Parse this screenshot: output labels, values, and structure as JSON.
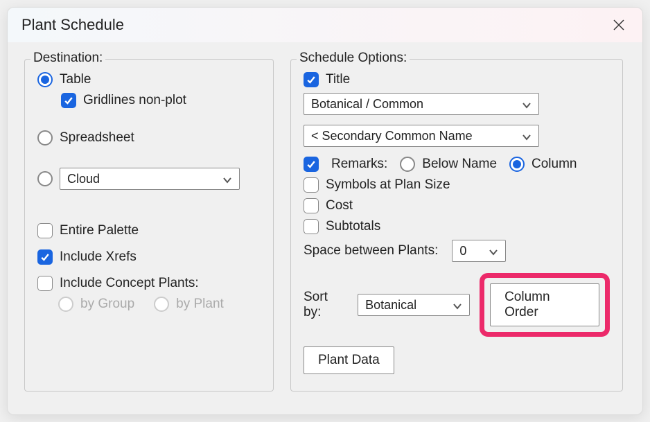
{
  "title": "Plant Schedule",
  "destination": {
    "legend": "Destination:",
    "table": "Table",
    "gridlines": "Gridlines non-plot",
    "spreadsheet": "Spreadsheet",
    "cloud": "Cloud",
    "entire_palette": "Entire Palette",
    "include_xrefs": "Include Xrefs",
    "include_concept": "Include Concept Plants:",
    "by_group": "by Group",
    "by_plant": "by Plant"
  },
  "options": {
    "legend": "Schedule Options:",
    "title_cb": "Title",
    "select1": "Botanical / Common",
    "select2": "< Secondary Common Name",
    "remarks": "Remarks:",
    "below_name": "Below Name",
    "column": "Column",
    "symbols": "Symbols at Plan Size",
    "cost": "Cost",
    "subtotals": "Subtotals",
    "space_between": "Space between Plants:",
    "space_value": "0",
    "sort_by": "Sort by:",
    "sort_value": "Botanical",
    "column_order": "Column Order",
    "plant_data": "Plant Data"
  }
}
